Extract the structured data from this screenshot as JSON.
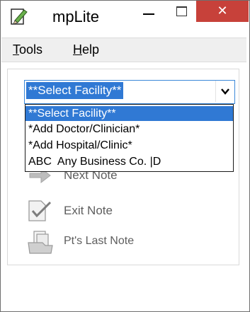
{
  "window": {
    "title": "mpLite",
    "icon": "pencil-icon",
    "controls": {
      "minimize": "minimize-icon",
      "maximize": "maximize-icon",
      "close": "✕"
    }
  },
  "menu": {
    "tools": {
      "accel": "T",
      "rest": "ools"
    },
    "help": {
      "accel": "H",
      "rest": "elp"
    }
  },
  "facility_select": {
    "value": "**Select Facility**",
    "options": [
      "**Select Facility**",
      "*Add Doctor/Clinician*",
      "*Add Hospital/Clinic*",
      "ABC  Any Business Co. |D"
    ],
    "selected_index": 0
  },
  "actions": [
    {
      "label": "Next Note",
      "icon": "arrow-right-icon"
    },
    {
      "label": "Exit Note",
      "icon": "document-check-icon"
    },
    {
      "label": "Pt's Last Note",
      "icon": "documents-icon"
    }
  ],
  "colors": {
    "accent": "#3079d4",
    "close": "#c7413a"
  }
}
